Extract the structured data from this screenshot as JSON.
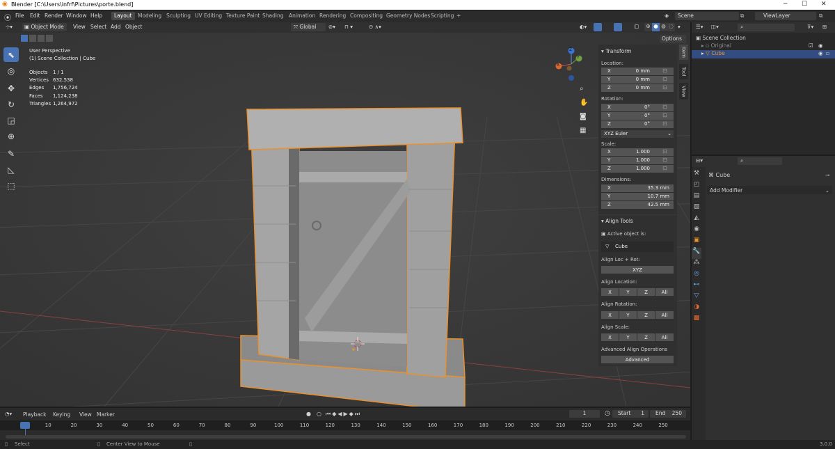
{
  "window": {
    "title": "Blender [C:\\Users\\infrf\\Pictures\\porte.blend]",
    "minimize": "─",
    "maximize": "☐",
    "close": "✕"
  },
  "menus": [
    "File",
    "Edit",
    "Render",
    "Window",
    "Help"
  ],
  "workspaces": [
    "Layout",
    "Modeling",
    "Sculpting",
    "UV Editing",
    "Texture Paint",
    "Shading",
    "Animation",
    "Rendering",
    "Compositing",
    "Geometry Nodes",
    "Scripting",
    "+"
  ],
  "scene": {
    "name": "Scene",
    "view_layer": "ViewLayer"
  },
  "viewport_header": {
    "mode": "Object Mode",
    "menus": [
      "View",
      "Select",
      "Add",
      "Object"
    ],
    "orientation": "Global",
    "options": "Options"
  },
  "viewport_info": {
    "view": "User Perspective",
    "collection": "(1) Scene Collection | Cube",
    "stats": [
      {
        "label": "Objects",
        "value": "1 / 1"
      },
      {
        "label": "Vertices",
        "value": "632,538"
      },
      {
        "label": "Edges",
        "value": "1,756,724"
      },
      {
        "label": "Faces",
        "value": "1,124,238"
      },
      {
        "label": "Triangles",
        "value": "1,264,972"
      }
    ]
  },
  "gizmo": {
    "x": "X",
    "y": "Y",
    "z": "Z"
  },
  "npanel": {
    "tabs": [
      "Item",
      "Tool",
      "View"
    ],
    "transform": "Transform",
    "location_label": "Location:",
    "location": [
      {
        "axis": "X",
        "value": "0 mm"
      },
      {
        "axis": "Y",
        "value": "0 mm"
      },
      {
        "axis": "Z",
        "value": "0 mm"
      }
    ],
    "rotation_label": "Rotation:",
    "rotation": [
      {
        "axis": "X",
        "value": "0°"
      },
      {
        "axis": "Y",
        "value": "0°"
      },
      {
        "axis": "Z",
        "value": "0°"
      }
    ],
    "rotation_mode": "XYZ Euler",
    "scale_label": "Scale:",
    "scale": [
      {
        "axis": "X",
        "value": "1.000"
      },
      {
        "axis": "Y",
        "value": "1.000"
      },
      {
        "axis": "Z",
        "value": "1.000"
      }
    ],
    "dimensions_label": "Dimensions:",
    "dimensions": [
      {
        "axis": "X",
        "value": "35.3 mm"
      },
      {
        "axis": "Y",
        "value": "10.7 mm"
      },
      {
        "axis": "Z",
        "value": "42.5 mm"
      }
    ],
    "align_tools": "Align Tools",
    "active_object_label": "Active object is:",
    "active_object": "Cube",
    "align_loc_rot": "Align Loc + Rot:",
    "xyz": "XYZ",
    "align_location": "Align Location:",
    "align_rotation": "Align Rotation:",
    "align_scale": "Align Scale:",
    "axis_buttons": [
      "X",
      "Y",
      "Z",
      "All"
    ],
    "advanced_ops": "Advanced Align Operations",
    "advanced": "Advanced"
  },
  "outliner": {
    "root": "Scene Collection",
    "items": [
      "Original",
      "Cube"
    ]
  },
  "properties": {
    "object": "Cube",
    "add_modifier": "Add Modifier"
  },
  "timeline": {
    "menus": [
      "Playback",
      "Keying",
      "View",
      "Marker"
    ],
    "current_frame": "1",
    "start_label": "Start",
    "start": "1",
    "end_label": "End",
    "end": "250",
    "ticks": [
      "1",
      "10",
      "20",
      "30",
      "40",
      "50",
      "60",
      "70",
      "80",
      "90",
      "100",
      "110",
      "120",
      "130",
      "140",
      "150",
      "160",
      "170",
      "180",
      "190",
      "200",
      "210",
      "220",
      "230",
      "240",
      "250"
    ]
  },
  "status": {
    "select": "Select",
    "center": "Center View to Mouse",
    "version": "3.0.0"
  },
  "colors": {
    "accent": "#4772b3",
    "selection": "#e8912e"
  }
}
